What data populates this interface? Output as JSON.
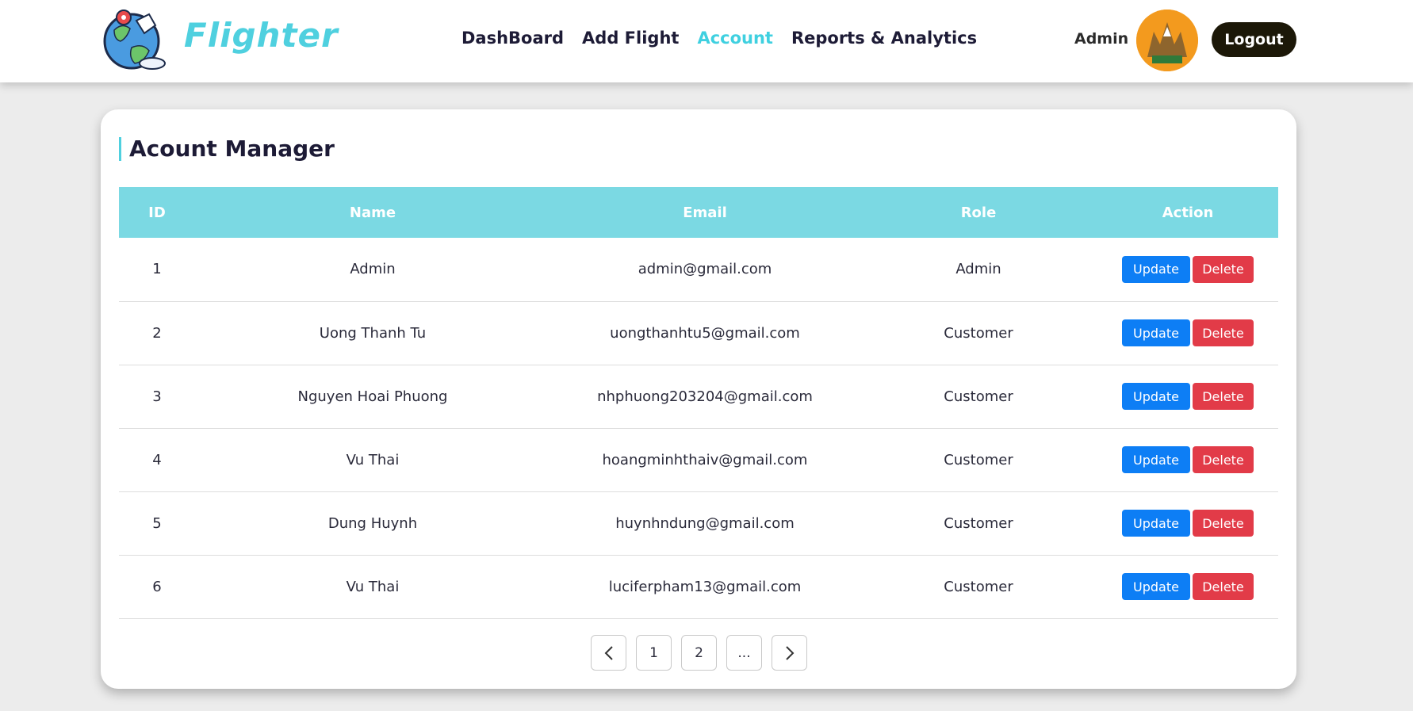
{
  "header": {
    "brand": "Flighter",
    "nav": [
      "DashBoard",
      "Add Flight",
      "Account",
      "Reports & Analytics"
    ],
    "active_nav": "Account",
    "admin_label": "Admin",
    "logout_label": "Logout"
  },
  "colors": {
    "accent": "#4fd0df",
    "table_header": "#7bd9e3",
    "update": "#0d7ef5",
    "delete": "#e23b48",
    "logout": "#1c1808"
  },
  "main": {
    "title": "Acount Manager",
    "columns": [
      "ID",
      "Name",
      "Email",
      "Role",
      "Action"
    ],
    "rows": [
      {
        "id": "1",
        "name": "Admin",
        "email": "admin@gmail.com",
        "role": "Admin"
      },
      {
        "id": "2",
        "name": "Uong Thanh Tu",
        "email": "uongthanhtu5@gmail.com",
        "role": "Customer"
      },
      {
        "id": "3",
        "name": "Nguyen Hoai Phuong",
        "email": "nhphuong203204@gmail.com",
        "role": "Customer"
      },
      {
        "id": "4",
        "name": "Vu Thai",
        "email": "hoangminhthaiv@gmail.com",
        "role": "Customer"
      },
      {
        "id": "5",
        "name": "Dung Huynh",
        "email": "huynhndung@gmail.com",
        "role": "Customer"
      },
      {
        "id": "6",
        "name": "Vu Thai",
        "email": "luciferpham13@gmail.com",
        "role": "Customer"
      }
    ],
    "update_label": "Update",
    "delete_label": "Delete"
  },
  "pagination": {
    "pages": [
      "1",
      "2",
      "..."
    ],
    "prev_icon": "chevron-left-icon",
    "next_icon": "chevron-right-icon"
  }
}
